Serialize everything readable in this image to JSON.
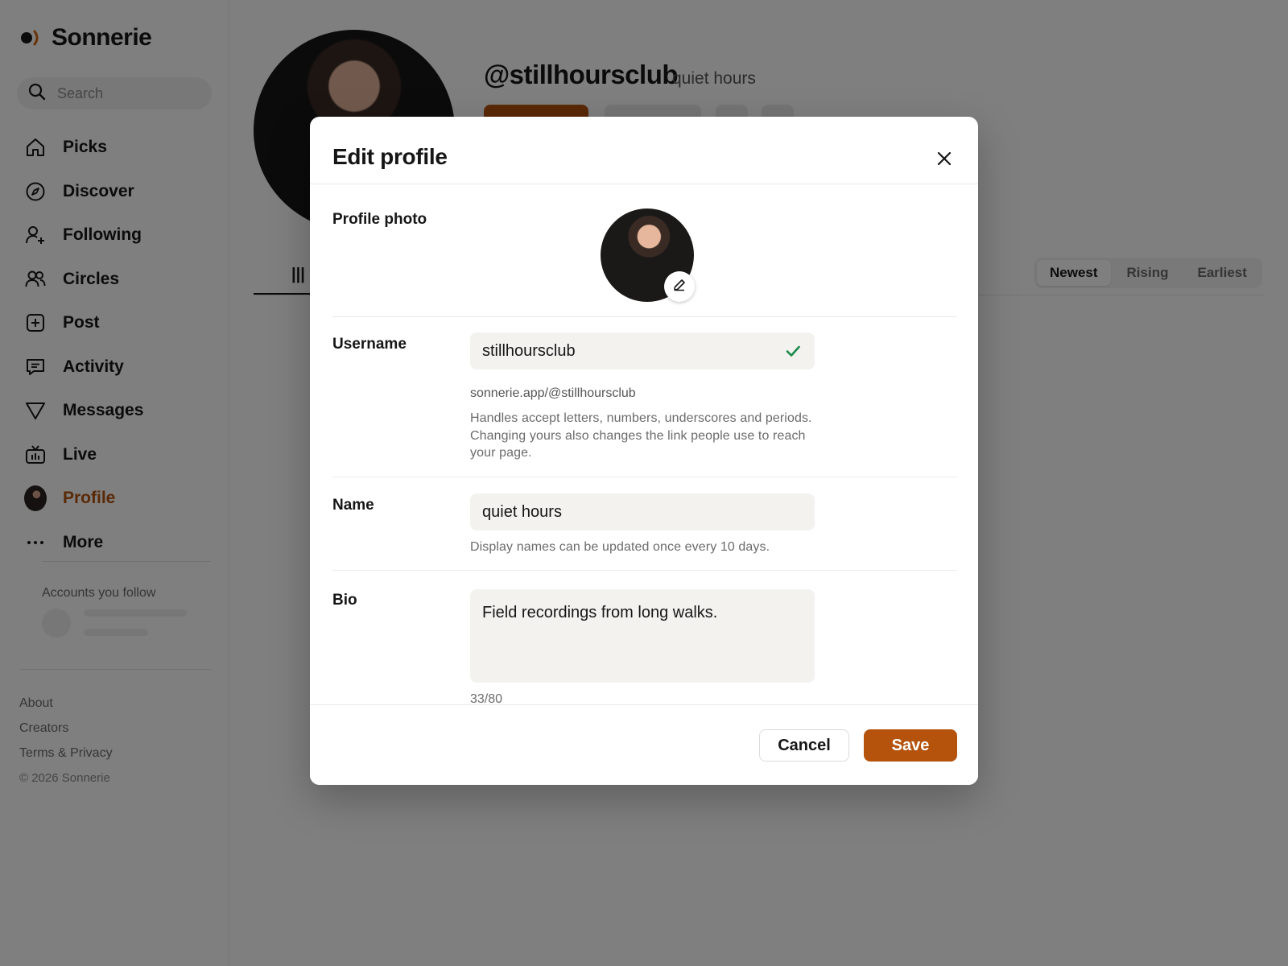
{
  "app": {
    "name": "Sonnerie"
  },
  "search": {
    "placeholder": "Search"
  },
  "sidebar": {
    "items": [
      {
        "label": "Picks",
        "icon": "home-icon"
      },
      {
        "label": "Discover",
        "icon": "compass-icon"
      },
      {
        "label": "Following",
        "icon": "user-plus-icon"
      },
      {
        "label": "Circles",
        "icon": "users-icon"
      },
      {
        "label": "Post",
        "icon": "plus-square-icon"
      },
      {
        "label": "Activity",
        "icon": "chat-icon"
      },
      {
        "label": "Messages",
        "icon": "send-icon"
      },
      {
        "label": "Live",
        "icon": "tv-icon"
      },
      {
        "label": "Profile",
        "icon": "avatar",
        "active": true
      },
      {
        "label": "More",
        "icon": "more-icon"
      }
    ],
    "follow_title": "Accounts you follow",
    "footer": {
      "about": "About",
      "creators": "Creators",
      "terms": "Terms & Privacy",
      "copyright": "© 2026 Sonnerie"
    }
  },
  "profile": {
    "handle": "@stillhoursclub",
    "display_name": "quiet hours",
    "sort_options": [
      "Newest",
      "Rising",
      "Earliest"
    ],
    "sort_selected": "Newest"
  },
  "modal": {
    "title": "Edit profile",
    "photo_label": "Profile photo",
    "username": {
      "label": "Username",
      "value": "stillhoursclub",
      "valid": true,
      "url": "sonnerie.app/@stillhoursclub",
      "help": "Handles accept letters, numbers, underscores and periods. Changing yours also changes the link people use to reach your page."
    },
    "name": {
      "label": "Name",
      "value": "quiet hours",
      "help": "Display names can be updated once every 10 days."
    },
    "bio": {
      "label": "Bio",
      "value": "Field recordings from long walks.",
      "counter": "33/80"
    },
    "cancel_label": "Cancel",
    "save_label": "Save"
  },
  "colors": {
    "accent": "#b5530d",
    "success": "#1a8a4a"
  }
}
